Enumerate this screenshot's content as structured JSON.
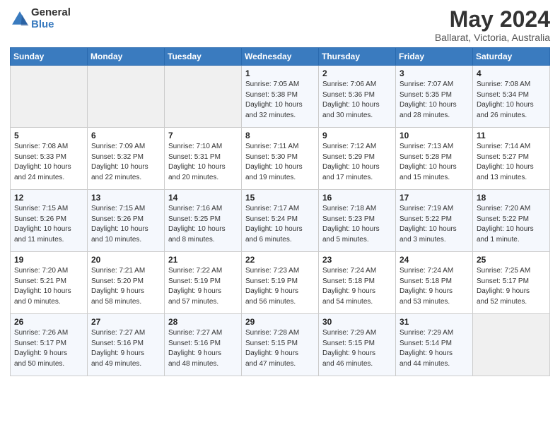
{
  "header": {
    "logo_general": "General",
    "logo_blue": "Blue",
    "month_title": "May 2024",
    "location": "Ballarat, Victoria, Australia"
  },
  "days_of_week": [
    "Sunday",
    "Monday",
    "Tuesday",
    "Wednesday",
    "Thursday",
    "Friday",
    "Saturday"
  ],
  "weeks": [
    [
      {
        "day": "",
        "info": ""
      },
      {
        "day": "",
        "info": ""
      },
      {
        "day": "",
        "info": ""
      },
      {
        "day": "1",
        "info": "Sunrise: 7:05 AM\nSunset: 5:38 PM\nDaylight: 10 hours\nand 32 minutes."
      },
      {
        "day": "2",
        "info": "Sunrise: 7:06 AM\nSunset: 5:36 PM\nDaylight: 10 hours\nand 30 minutes."
      },
      {
        "day": "3",
        "info": "Sunrise: 7:07 AM\nSunset: 5:35 PM\nDaylight: 10 hours\nand 28 minutes."
      },
      {
        "day": "4",
        "info": "Sunrise: 7:08 AM\nSunset: 5:34 PM\nDaylight: 10 hours\nand 26 minutes."
      }
    ],
    [
      {
        "day": "5",
        "info": "Sunrise: 7:08 AM\nSunset: 5:33 PM\nDaylight: 10 hours\nand 24 minutes."
      },
      {
        "day": "6",
        "info": "Sunrise: 7:09 AM\nSunset: 5:32 PM\nDaylight: 10 hours\nand 22 minutes."
      },
      {
        "day": "7",
        "info": "Sunrise: 7:10 AM\nSunset: 5:31 PM\nDaylight: 10 hours\nand 20 minutes."
      },
      {
        "day": "8",
        "info": "Sunrise: 7:11 AM\nSunset: 5:30 PM\nDaylight: 10 hours\nand 19 minutes."
      },
      {
        "day": "9",
        "info": "Sunrise: 7:12 AM\nSunset: 5:29 PM\nDaylight: 10 hours\nand 17 minutes."
      },
      {
        "day": "10",
        "info": "Sunrise: 7:13 AM\nSunset: 5:28 PM\nDaylight: 10 hours\nand 15 minutes."
      },
      {
        "day": "11",
        "info": "Sunrise: 7:14 AM\nSunset: 5:27 PM\nDaylight: 10 hours\nand 13 minutes."
      }
    ],
    [
      {
        "day": "12",
        "info": "Sunrise: 7:15 AM\nSunset: 5:26 PM\nDaylight: 10 hours\nand 11 minutes."
      },
      {
        "day": "13",
        "info": "Sunrise: 7:15 AM\nSunset: 5:26 PM\nDaylight: 10 hours\nand 10 minutes."
      },
      {
        "day": "14",
        "info": "Sunrise: 7:16 AM\nSunset: 5:25 PM\nDaylight: 10 hours\nand 8 minutes."
      },
      {
        "day": "15",
        "info": "Sunrise: 7:17 AM\nSunset: 5:24 PM\nDaylight: 10 hours\nand 6 minutes."
      },
      {
        "day": "16",
        "info": "Sunrise: 7:18 AM\nSunset: 5:23 PM\nDaylight: 10 hours\nand 5 minutes."
      },
      {
        "day": "17",
        "info": "Sunrise: 7:19 AM\nSunset: 5:22 PM\nDaylight: 10 hours\nand 3 minutes."
      },
      {
        "day": "18",
        "info": "Sunrise: 7:20 AM\nSunset: 5:22 PM\nDaylight: 10 hours\nand 1 minute."
      }
    ],
    [
      {
        "day": "19",
        "info": "Sunrise: 7:20 AM\nSunset: 5:21 PM\nDaylight: 10 hours\nand 0 minutes."
      },
      {
        "day": "20",
        "info": "Sunrise: 7:21 AM\nSunset: 5:20 PM\nDaylight: 9 hours\nand 58 minutes."
      },
      {
        "day": "21",
        "info": "Sunrise: 7:22 AM\nSunset: 5:19 PM\nDaylight: 9 hours\nand 57 minutes."
      },
      {
        "day": "22",
        "info": "Sunrise: 7:23 AM\nSunset: 5:19 PM\nDaylight: 9 hours\nand 56 minutes."
      },
      {
        "day": "23",
        "info": "Sunrise: 7:24 AM\nSunset: 5:18 PM\nDaylight: 9 hours\nand 54 minutes."
      },
      {
        "day": "24",
        "info": "Sunrise: 7:24 AM\nSunset: 5:18 PM\nDaylight: 9 hours\nand 53 minutes."
      },
      {
        "day": "25",
        "info": "Sunrise: 7:25 AM\nSunset: 5:17 PM\nDaylight: 9 hours\nand 52 minutes."
      }
    ],
    [
      {
        "day": "26",
        "info": "Sunrise: 7:26 AM\nSunset: 5:17 PM\nDaylight: 9 hours\nand 50 minutes."
      },
      {
        "day": "27",
        "info": "Sunrise: 7:27 AM\nSunset: 5:16 PM\nDaylight: 9 hours\nand 49 minutes."
      },
      {
        "day": "28",
        "info": "Sunrise: 7:27 AM\nSunset: 5:16 PM\nDaylight: 9 hours\nand 48 minutes."
      },
      {
        "day": "29",
        "info": "Sunrise: 7:28 AM\nSunset: 5:15 PM\nDaylight: 9 hours\nand 47 minutes."
      },
      {
        "day": "30",
        "info": "Sunrise: 7:29 AM\nSunset: 5:15 PM\nDaylight: 9 hours\nand 46 minutes."
      },
      {
        "day": "31",
        "info": "Sunrise: 7:29 AM\nSunset: 5:14 PM\nDaylight: 9 hours\nand 44 minutes."
      },
      {
        "day": "",
        "info": ""
      }
    ]
  ]
}
